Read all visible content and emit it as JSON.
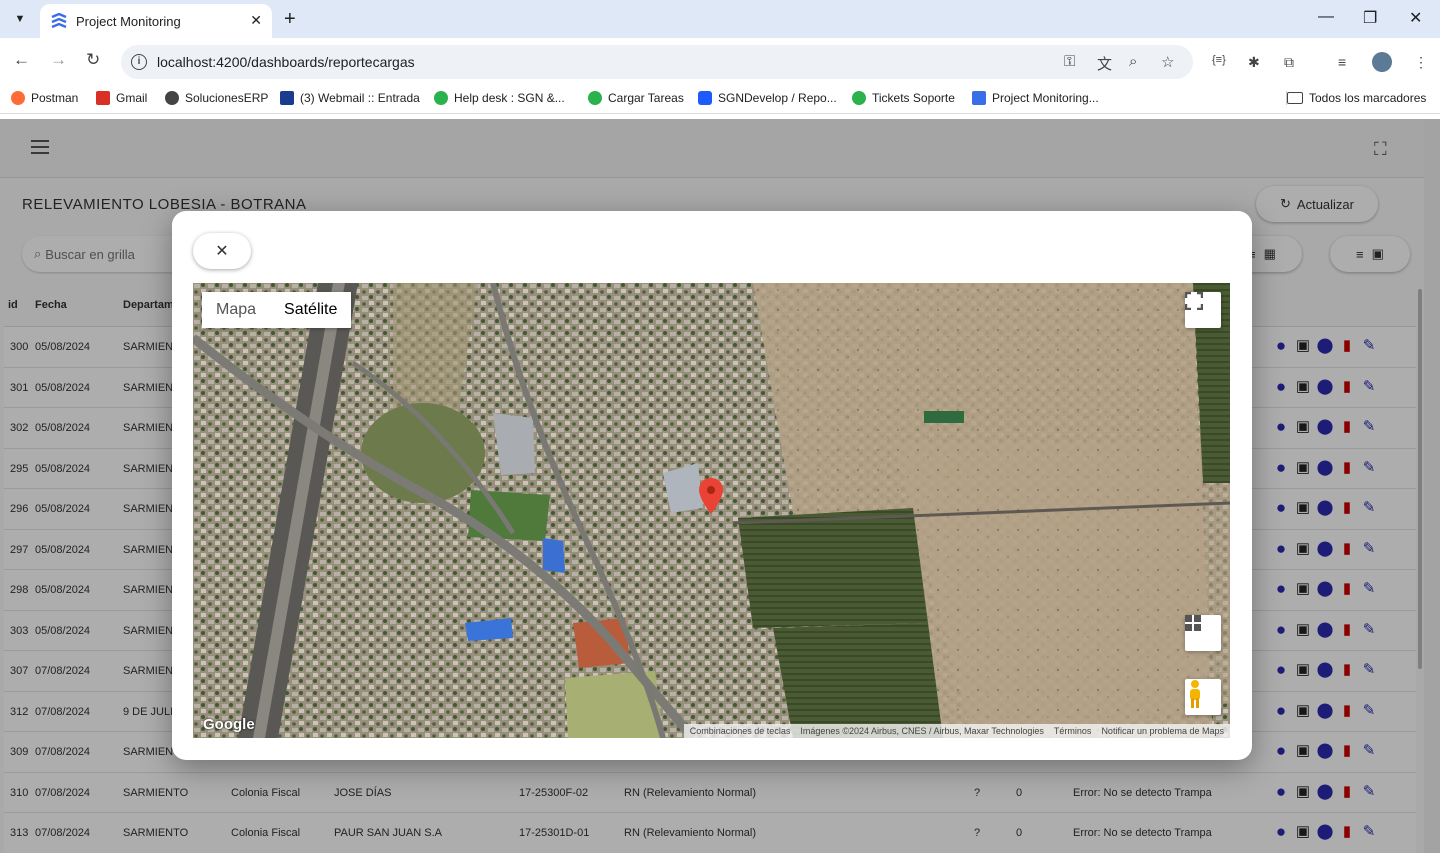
{
  "browser": {
    "tab_title": "Project Monitoring",
    "url": "localhost:4200/dashboards/reportecargas",
    "bookmarks": [
      {
        "label": "Postman",
        "color": "#ff6c37"
      },
      {
        "label": "Gmail",
        "color": "#d93025"
      },
      {
        "label": "SolucionesERP",
        "color": "#444444"
      },
      {
        "label": "(3) Webmail :: Entrada",
        "color": "#1a3c8f"
      },
      {
        "label": "Help desk : SGN &...",
        "color": "#2bb24c"
      },
      {
        "label": "Cargar Tareas",
        "color": "#2bb24c"
      },
      {
        "label": "SGNDevelop / Repo...",
        "color": "#1e5bff"
      },
      {
        "label": "Tickets Soporte",
        "color": "#2bb24c"
      },
      {
        "label": "Project Monitoring...",
        "color": "#3a6ee8"
      }
    ],
    "all_bookmarks": "Todos los marcadores"
  },
  "page": {
    "title": "RELEVAMIENTO LOBESIA - BOTRANA",
    "refresh_label": "Actualizar",
    "search_placeholder": "Buscar en grilla"
  },
  "grid": {
    "headers": {
      "id": "id",
      "fecha": "Fecha",
      "departamento": "Departam"
    },
    "rows": [
      {
        "id": "300",
        "fecha": "05/08/2024",
        "depto": "SARMIEN"
      },
      {
        "id": "301",
        "fecha": "05/08/2024",
        "depto": "SARMIEN"
      },
      {
        "id": "302",
        "fecha": "05/08/2024",
        "depto": "SARMIEN"
      },
      {
        "id": "295",
        "fecha": "05/08/2024",
        "depto": "SARMIEN"
      },
      {
        "id": "296",
        "fecha": "05/08/2024",
        "depto": "SARMIEN"
      },
      {
        "id": "297",
        "fecha": "05/08/2024",
        "depto": "SARMIEN"
      },
      {
        "id": "298",
        "fecha": "05/08/2024",
        "depto": "SARMIEN"
      },
      {
        "id": "303",
        "fecha": "05/08/2024",
        "depto": "SARMIEN"
      },
      {
        "id": "307",
        "fecha": "07/08/2024",
        "depto": "SARMIEN"
      },
      {
        "id": "312",
        "fecha": "07/08/2024",
        "depto": "9 DE JULI"
      },
      {
        "id": "309",
        "fecha": "07/08/2024",
        "depto": "SARMIEN"
      }
    ],
    "full_rows": [
      {
        "id": "310",
        "fecha": "07/08/2024",
        "depto": "SARMIENTO",
        "distrito": "Colonia Fiscal",
        "productor": "JOSE DÍAS",
        "codigo": "17-25300F-02",
        "tipo": "RN (Relevamiento Normal)",
        "q": "?",
        "n": "0",
        "error": "Error: No se detecto Trampa"
      },
      {
        "id": "313",
        "fecha": "07/08/2024",
        "depto": "SARMIENTO",
        "distrito": "Colonia Fiscal",
        "productor": "PAUR SAN JUAN S.A",
        "codigo": "17-25301D-01",
        "tipo": "RN (Relevamiento Normal)",
        "q": "?",
        "n": "0",
        "error": "Error: No se detecto Trampa"
      }
    ]
  },
  "map": {
    "type_map": "Mapa",
    "type_satellite": "Satélite",
    "logo": "Google",
    "attribution": {
      "shortcuts": "Combinaciones de teclas",
      "imagery": "Imágenes ©2024 Airbus, CNES / Airbus, Maxar Technologies",
      "terms": "Términos",
      "report": "Notificar un problema de Maps"
    }
  }
}
